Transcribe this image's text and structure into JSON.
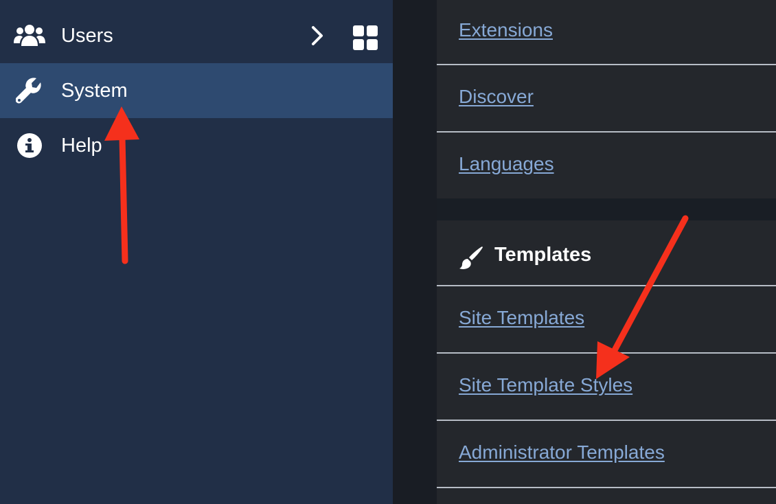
{
  "sidebar": {
    "items": [
      {
        "label": "Users",
        "icon": "users-icon",
        "active": false
      },
      {
        "label": "System",
        "icon": "wrench-icon",
        "active": true
      },
      {
        "label": "Help",
        "icon": "info-icon",
        "active": false
      }
    ]
  },
  "content": {
    "top_links": [
      "Extensions",
      "Discover",
      "Languages"
    ],
    "templates_section": {
      "heading": "Templates",
      "icon": "paint-brush-icon",
      "links": [
        "Site Templates",
        "Site Template Styles",
        "Administrator Templates"
      ]
    }
  },
  "colors": {
    "sidebar_bg": "#212f47",
    "sidebar_active_bg": "#2e4a70",
    "panel_bg": "#24272c",
    "link": "#87a9d6",
    "annotation_arrow": "#f5301c"
  }
}
